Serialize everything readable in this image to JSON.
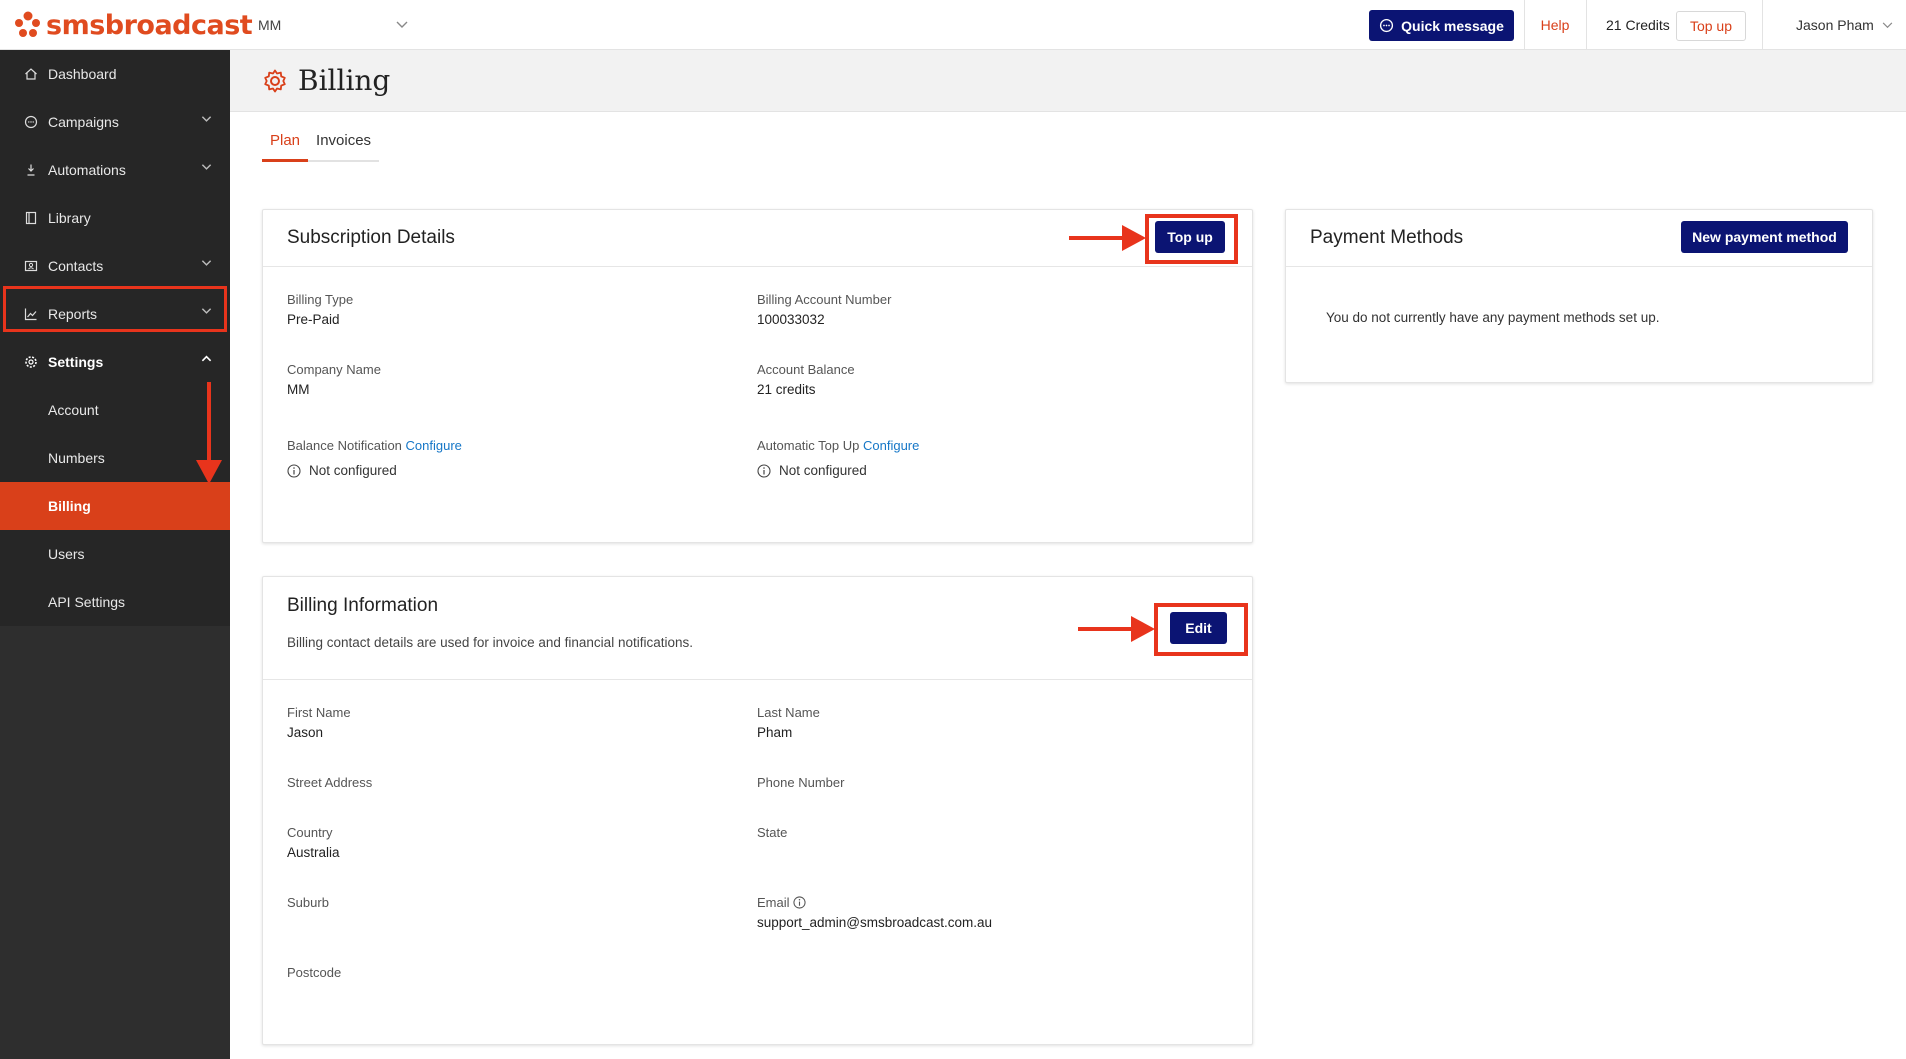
{
  "brand": {
    "logo_text": "smsbroadcast",
    "accent": "#d9401a",
    "navy": "#0b1473",
    "annotation": "#e8341c"
  },
  "header": {
    "account": "MM",
    "quick_message": "Quick message",
    "help": "Help",
    "credits": "21 Credits",
    "topup": "Top up",
    "user": "Jason Pham"
  },
  "sidebar": {
    "items": [
      {
        "label": "Dashboard",
        "icon": "home-icon"
      },
      {
        "label": "Campaigns",
        "icon": "chat-icon"
      },
      {
        "label": "Automations",
        "icon": "automation-icon"
      },
      {
        "label": "Library",
        "icon": "library-icon"
      },
      {
        "label": "Contacts",
        "icon": "contacts-icon"
      },
      {
        "label": "Reports",
        "icon": "chart-icon"
      },
      {
        "label": "Settings",
        "icon": "gear-icon"
      }
    ],
    "sub_items": [
      "Account",
      "Numbers",
      "Billing",
      "Users",
      "API Settings"
    ],
    "active": "Billing"
  },
  "page": {
    "title": "Billing",
    "tabs": [
      "Plan",
      "Invoices"
    ],
    "active_tab": "Plan"
  },
  "subscription": {
    "title": "Subscription Details",
    "topup": "Top up",
    "billing_type_label": "Billing Type",
    "billing_type": "Pre-Paid",
    "account_number_label": "Billing Account Number",
    "account_number": "100033032",
    "company_label": "Company Name",
    "company": "MM",
    "balance_label": "Account Balance",
    "balance": "21 credits",
    "balance_notification_label": "Balance Notification",
    "configure": "Configure",
    "balance_notification_status": "Not configured",
    "auto_topup_label": "Automatic Top Up",
    "auto_topup_status": "Not configured"
  },
  "payment": {
    "title": "Payment Methods",
    "new_button": "New payment method",
    "empty": "You do not currently have any payment methods set up."
  },
  "billing_info": {
    "title": "Billing Information",
    "subtitle": "Billing contact details are used for invoice and financial notifications.",
    "edit": "Edit",
    "first_name_label": "First Name",
    "first_name": "Jason",
    "last_name_label": "Last Name",
    "last_name": "Pham",
    "street_label": "Street Address",
    "phone_label": "Phone Number",
    "country_label": "Country",
    "country": "Australia",
    "state_label": "State",
    "suburb_label": "Suburb",
    "email_label": "Email",
    "email": "support_admin@smsbroadcast.com.au",
    "postcode_label": "Postcode"
  }
}
